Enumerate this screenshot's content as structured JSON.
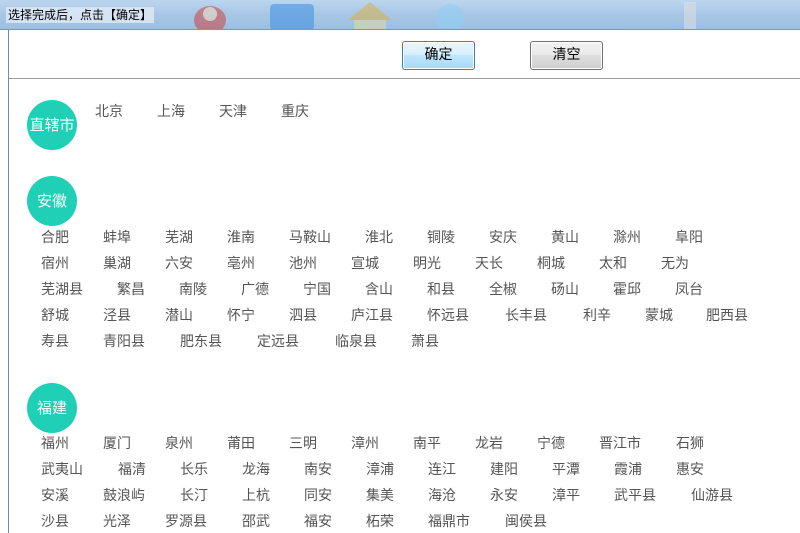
{
  "window": {
    "title": "选择完成后，点击【确定】"
  },
  "toolbar": {
    "confirm_label": "确定",
    "clear_label": "清空"
  },
  "sections": {
    "municipalities": {
      "name": "直辖市",
      "cities": [
        "北京",
        "上海",
        "天津",
        "重庆"
      ]
    },
    "anhui": {
      "name": "安徽",
      "rows": [
        [
          "合肥",
          "蚌埠",
          "芜湖",
          "淮南",
          "马鞍山",
          "淮北",
          "铜陵",
          "安庆",
          "黄山",
          "滁州",
          "阜阳"
        ],
        [
          "宿州",
          "巢湖",
          "六安",
          "亳州",
          "池州",
          "宣城",
          "明光",
          "天长",
          "桐城",
          "太和",
          "无为"
        ],
        [
          "芜湖县",
          "繁昌",
          "南陵",
          "广德",
          "宁国",
          "含山",
          "和县",
          "全椒",
          "砀山",
          "霍邱",
          "凤台"
        ],
        [
          "舒城",
          "泾县",
          "潜山",
          "怀宁",
          "泗县",
          "庐江县",
          "怀远县",
          "长丰县",
          "利辛",
          "蒙城",
          "肥西县"
        ],
        [
          "寿县",
          "青阳县",
          "肥东县",
          "定远县",
          "临泉县",
          "萧县"
        ]
      ]
    },
    "fujian": {
      "name": "福建",
      "rows": [
        [
          "福州",
          "厦门",
          "泉州",
          "莆田",
          "三明",
          "漳州",
          "南平",
          "龙岩",
          "宁德",
          "晋江市",
          "石狮"
        ],
        [
          "武夷山",
          "福清",
          "长乐",
          "龙海",
          "南安",
          "漳浦",
          "连江",
          "建阳",
          "平潭",
          "霞浦",
          "惠安"
        ],
        [
          "安溪",
          "鼓浪屿",
          "长汀",
          "上杭",
          "同安",
          "集美",
          "海沧",
          "永安",
          "漳平",
          "武平县",
          "仙游县"
        ],
        [
          "沙县",
          "光泽",
          "罗源县",
          "邵武",
          "福安",
          "柘荣",
          "福鼎市",
          "闽侯县"
        ]
      ]
    }
  },
  "colors": {
    "badge": "#1fcfb6",
    "city_text": "#555555"
  }
}
